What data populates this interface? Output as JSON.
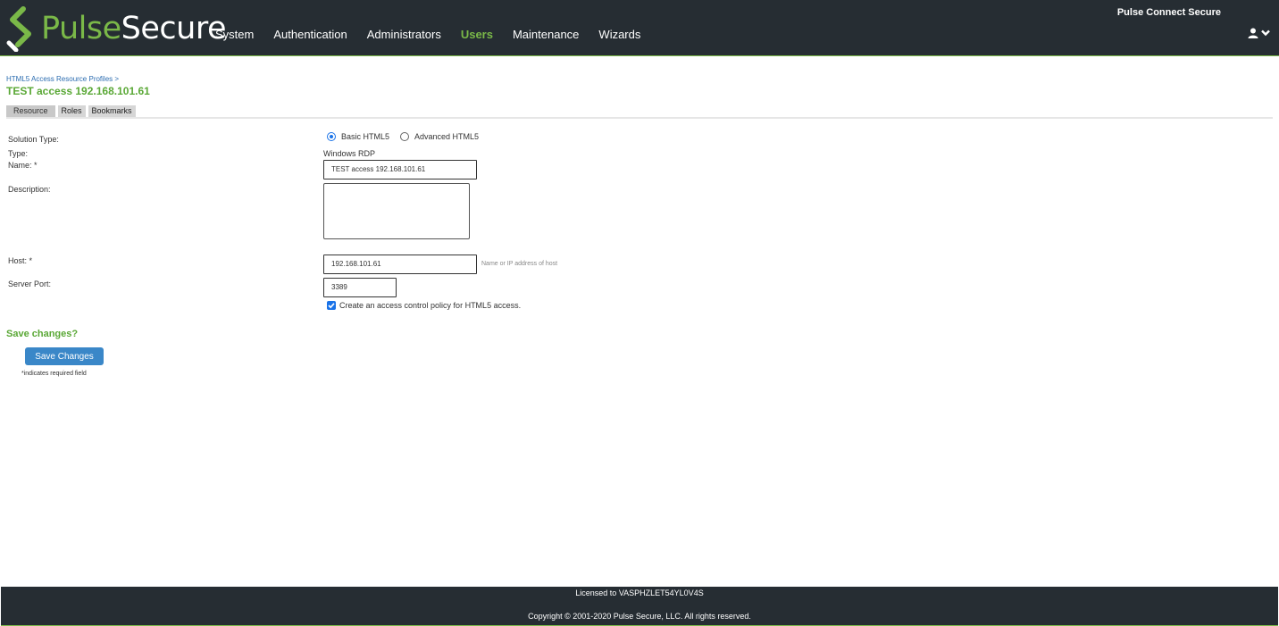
{
  "header": {
    "brand_pulse": "Pulse",
    "brand_secure": "Secure",
    "product_name": "Pulse Connect Secure",
    "nav": [
      "System",
      "Authentication",
      "Administrators",
      "Users",
      "Maintenance",
      "Wizards"
    ],
    "active_nav": "Users",
    "accent_color": "#7ab848",
    "user_icon": "user-icon",
    "menu_icon": "chevron-down-icon"
  },
  "breadcrumb": {
    "link": "HTML5 Access Resource Profiles",
    "separator": ">"
  },
  "page_title": "TEST access 192.168.101.61",
  "tabs": [
    "Resource",
    "Roles",
    "Bookmarks"
  ],
  "current_tab": "Resource",
  "form": {
    "solution_type_label": "Solution Type:",
    "solution_options": [
      "Basic HTML5",
      "Advanced HTML5"
    ],
    "solution_selected": "Basic HTML5",
    "type_label": "Type:",
    "type_value": "Windows RDP",
    "name_label": "Name: *",
    "name_value": "TEST access 192.168.101.61",
    "description_label": "Description:",
    "description_value": "",
    "host_label": "Host: *",
    "host_value": "192.168.101.61",
    "host_hint": "Name or IP address of host",
    "port_label": "Server Port:",
    "port_value": "3389",
    "acl_checkbox_label": "Create an access control policy for HTML5 access.",
    "acl_checked": true
  },
  "save": {
    "question": "Save changes?",
    "button_label": "Save Changes",
    "required_note": "*indicates required field"
  },
  "footer": {
    "license": "Licensed to VASPHZLET54YL0V4S",
    "copyright": "Copyright © 2001-2020 Pulse Secure, LLC. All rights reserved."
  }
}
